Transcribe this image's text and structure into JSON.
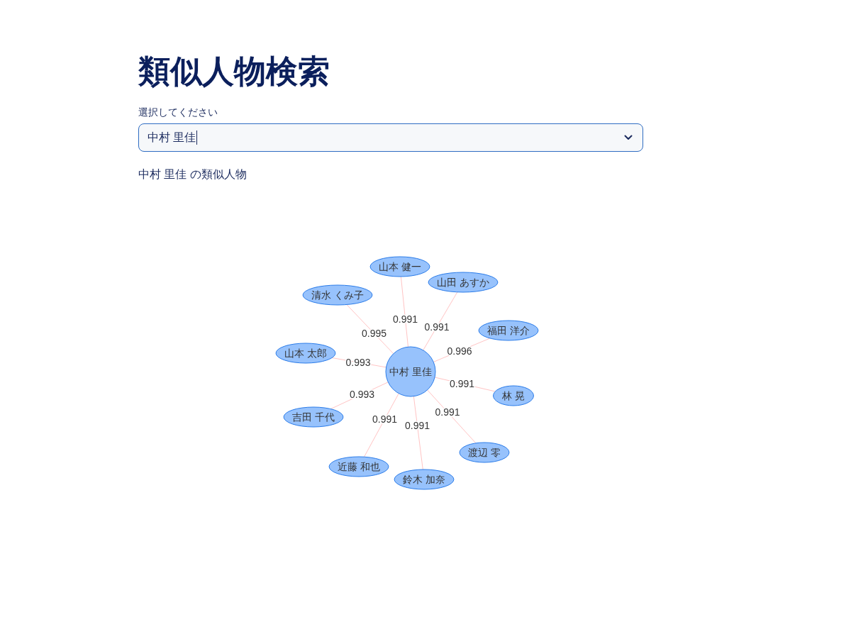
{
  "title": "類似人物検索",
  "select": {
    "label": "選択してください",
    "value": "中村 里佳",
    "focused": true
  },
  "result_heading": "中村 里佳 の類似人物",
  "graph": {
    "center": {
      "name": "中村 里佳"
    },
    "neighbors": [
      {
        "name": "山本 健一",
        "similarity": "0.991"
      },
      {
        "name": "山田 あすか",
        "similarity": "0.991"
      },
      {
        "name": "清水 くみ子",
        "similarity": "0.995"
      },
      {
        "name": "福田 洋介",
        "similarity": "0.996"
      },
      {
        "name": "山本 太郎",
        "similarity": "0.993"
      },
      {
        "name": "林 晃",
        "similarity": "0.991"
      },
      {
        "name": "吉田 千代",
        "similarity": "0.993"
      },
      {
        "name": "渡辺 零",
        "similarity": "0.991"
      },
      {
        "name": "近藤 和也",
        "similarity": "0.991"
      },
      {
        "name": "鈴木 加奈",
        "similarity": "0.991"
      }
    ]
  }
}
